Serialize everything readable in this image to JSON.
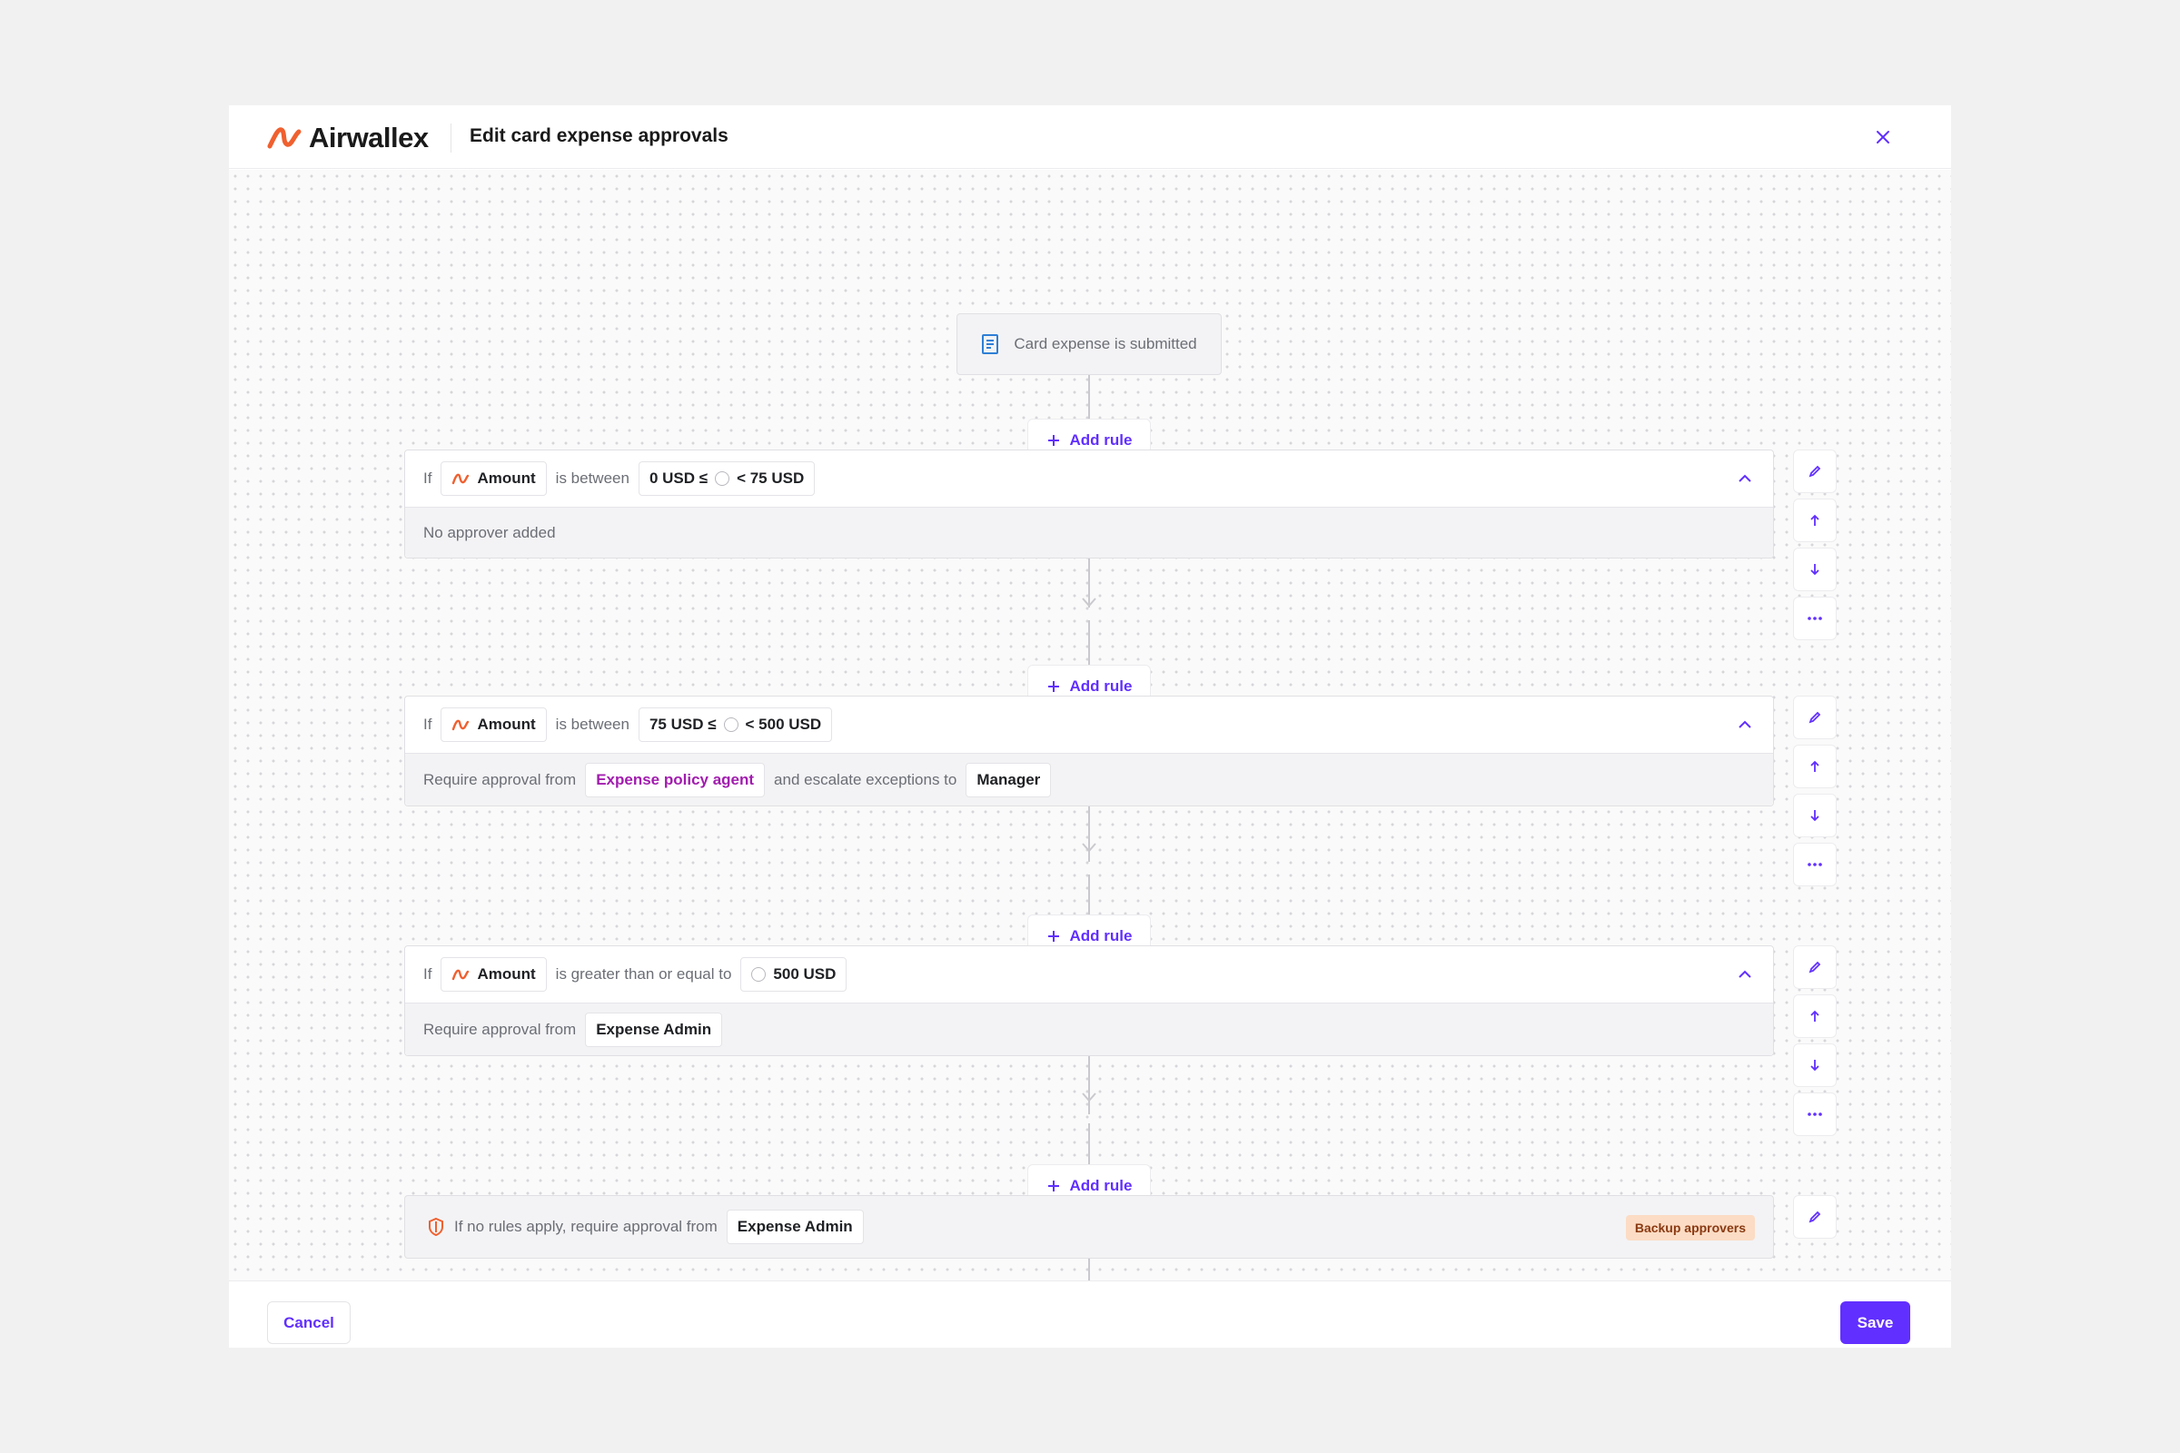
{
  "header": {
    "brand": "Airwallex",
    "title": "Edit card expense approvals"
  },
  "trigger": {
    "label": "Card expense is submitted"
  },
  "add_rule_label": "Add rule",
  "rules": [
    {
      "if_label": "If",
      "field": "Amount",
      "operator": "is between",
      "range_low": "0 USD ≤",
      "range_high": "< 75 USD",
      "result_text": "No approver added"
    },
    {
      "if_label": "If",
      "field": "Amount",
      "operator": "is between",
      "range_low": "75 USD ≤",
      "range_high": "< 500 USD",
      "result_prefix": "Require approval from",
      "approver": "Expense policy agent",
      "escalate_text": "and escalate exceptions to",
      "escalate_to": "Manager"
    },
    {
      "if_label": "If",
      "field": "Amount",
      "operator": "is greater than or equal to",
      "value": "500 USD",
      "result_prefix": "Require approval from",
      "approver": "Expense Admin"
    }
  ],
  "fallback": {
    "text": "If no rules apply, require approval from",
    "approver": "Expense Admin",
    "badge": "Backup approvers"
  },
  "footer": {
    "cancel_label": "Cancel",
    "save_label": "Save"
  },
  "colors": {
    "accent": "#612fff",
    "brand_orange": "#f0602f",
    "agent_magenta": "#a21caf",
    "badge_bg": "#fcdcc4"
  }
}
